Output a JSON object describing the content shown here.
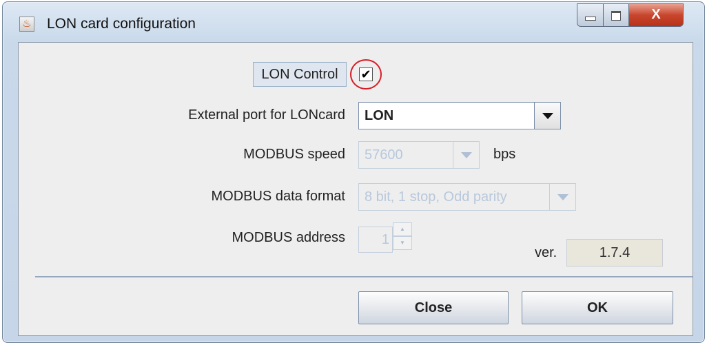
{
  "window": {
    "title": "LON card configuration",
    "icon": "java-cup-icon",
    "controls": {
      "minimize": "minimize",
      "maximize": "maximize",
      "close": "X"
    }
  },
  "lon_control": {
    "label": "LON Control",
    "checked": true,
    "check_glyph": "✔"
  },
  "external_port": {
    "label": "External port for LONcard",
    "value": "LON"
  },
  "modbus_speed": {
    "label": "MODBUS speed",
    "value": "57600",
    "unit": "bps",
    "enabled": false
  },
  "modbus_format": {
    "label": "MODBUS data format",
    "value": "8 bit, 1 stop, Odd parity",
    "enabled": false
  },
  "modbus_address": {
    "label": "MODBUS address",
    "value": "1",
    "enabled": false
  },
  "version": {
    "label": "ver.",
    "value": "1.7.4"
  },
  "buttons": {
    "close": "Close",
    "ok": "OK"
  },
  "colors": {
    "highlight_circle": "#d6202a",
    "title_bar": "#dde8f4",
    "client_bg": "#eeeeee"
  }
}
